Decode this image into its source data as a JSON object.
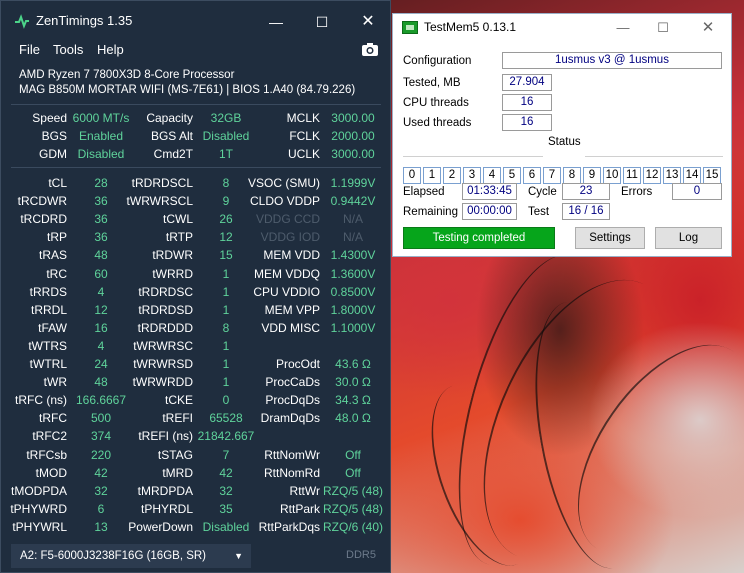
{
  "zentimings": {
    "title": "ZenTimings 1.35",
    "menu": [
      "File",
      "Tools",
      "Help"
    ],
    "cpu": "AMD Ryzen 7 7800X3D 8-Core Processor",
    "board": "MAG B850M MORTAR WIFI (MS-7E61) | BIOS 1.A40 (84.79.226)",
    "top": [
      [
        "Speed",
        "6000 MT/s",
        "Capacity",
        "32GB",
        "MCLK",
        "3000.00"
      ],
      [
        "BGS",
        "Enabled",
        "BGS Alt",
        "Disabled",
        "FCLK",
        "2000.00"
      ],
      [
        "GDM",
        "Disabled",
        "Cmd2T",
        "1T",
        "UCLK",
        "3000.00"
      ]
    ],
    "timings": [
      [
        "tCL",
        "28",
        "tRDRDSCL",
        "8",
        "VSOC (SMU)",
        "1.1999V"
      ],
      [
        "tRCDWR",
        "36",
        "tWRWRSCL",
        "9",
        "CLDO VDDP",
        "0.9442V"
      ],
      [
        "tRCDRD",
        "36",
        "tCWL",
        "26",
        "VDDG CCD",
        "N/A"
      ],
      [
        "tRP",
        "36",
        "tRTP",
        "12",
        "VDDG IOD",
        "N/A"
      ],
      [
        "tRAS",
        "48",
        "tRDWR",
        "15",
        "MEM VDD",
        "1.4300V"
      ],
      [
        "tRC",
        "60",
        "tWRRD",
        "1",
        "MEM VDDQ",
        "1.3600V"
      ],
      [
        "tRRDS",
        "4",
        "tRDRDSC",
        "1",
        "CPU VDDIO",
        "0.8500V"
      ],
      [
        "tRRDL",
        "12",
        "tRDRDSD",
        "1",
        "MEM VPP",
        "1.8000V"
      ],
      [
        "tFAW",
        "16",
        "tRDRDDD",
        "8",
        "VDD MISC",
        "1.1000V"
      ],
      [
        "tWTRS",
        "4",
        "tWRWRSC",
        "1",
        "",
        ""
      ],
      [
        "tWTRL",
        "24",
        "tWRWRSD",
        "1",
        "ProcOdt",
        "43.6 Ω"
      ],
      [
        "tWR",
        "48",
        "tWRWRDD",
        "1",
        "ProcCaDs",
        "30.0 Ω"
      ],
      [
        "tRFC (ns)",
        "166.6667",
        "tCKE",
        "0",
        "ProcDqDs",
        "34.3 Ω"
      ],
      [
        "tRFC",
        "500",
        "tREFI",
        "65528",
        "DramDqDs",
        "48.0 Ω"
      ],
      [
        "tRFC2",
        "374",
        "tREFI (ns)",
        "21842.667",
        "",
        ""
      ],
      [
        "tRFCsb",
        "220",
        "tSTAG",
        "7",
        "RttNomWr",
        "Off"
      ],
      [
        "tMOD",
        "42",
        "tMRD",
        "42",
        "RttNomRd",
        "Off"
      ],
      [
        "tMODPDA",
        "32",
        "tMRDPDA",
        "32",
        "RttWr",
        "RZQ/5 (48)"
      ],
      [
        "tPHYWRD",
        "6",
        "tPHYRDL",
        "35",
        "RttPark",
        "RZQ/5 (48)"
      ],
      [
        "tPHYWRL",
        "13",
        "PowerDown",
        "Disabled",
        "RttParkDqs",
        "RZQ/6 (40)"
      ]
    ],
    "dimm_selected": "A2: F5-6000J3238F16G (16GB, SR)",
    "ddr": "DDR5"
  },
  "testmem": {
    "title": "TestMem5  0.13.1",
    "config_label": "Configuration",
    "config_value": "1usmus v3 @ 1usmus",
    "tested_label": "Tested, MB",
    "tested_value": "27.904",
    "cpu_threads_label": "CPU threads",
    "cpu_threads_value": "16",
    "used_threads_label": "Used threads",
    "used_threads_value": "16",
    "status_label": "Status",
    "threads": [
      "0",
      "1",
      "2",
      "3",
      "4",
      "5",
      "6",
      "7",
      "8",
      "9",
      "10",
      "11",
      "12",
      "13",
      "14",
      "15"
    ],
    "elapsed_label": "Elapsed",
    "elapsed_value": "01:33:45",
    "cycle_label": "Cycle",
    "cycle_value": "23",
    "errors_label": "Errors",
    "errors_value": "0",
    "remaining_label": "Remaining",
    "remaining_value": "00:00:00",
    "test_label": "Test",
    "test_value": "16 / 16",
    "progress_text": "Testing completed",
    "settings_label": "Settings",
    "log_label": "Log"
  },
  "colors": {
    "zt_background": "#1f2d3e",
    "zt_value": "#5fd39b",
    "zt_dim": "#4e5c6c",
    "tm_progress": "#06a51b",
    "tm_value": "#000080"
  }
}
